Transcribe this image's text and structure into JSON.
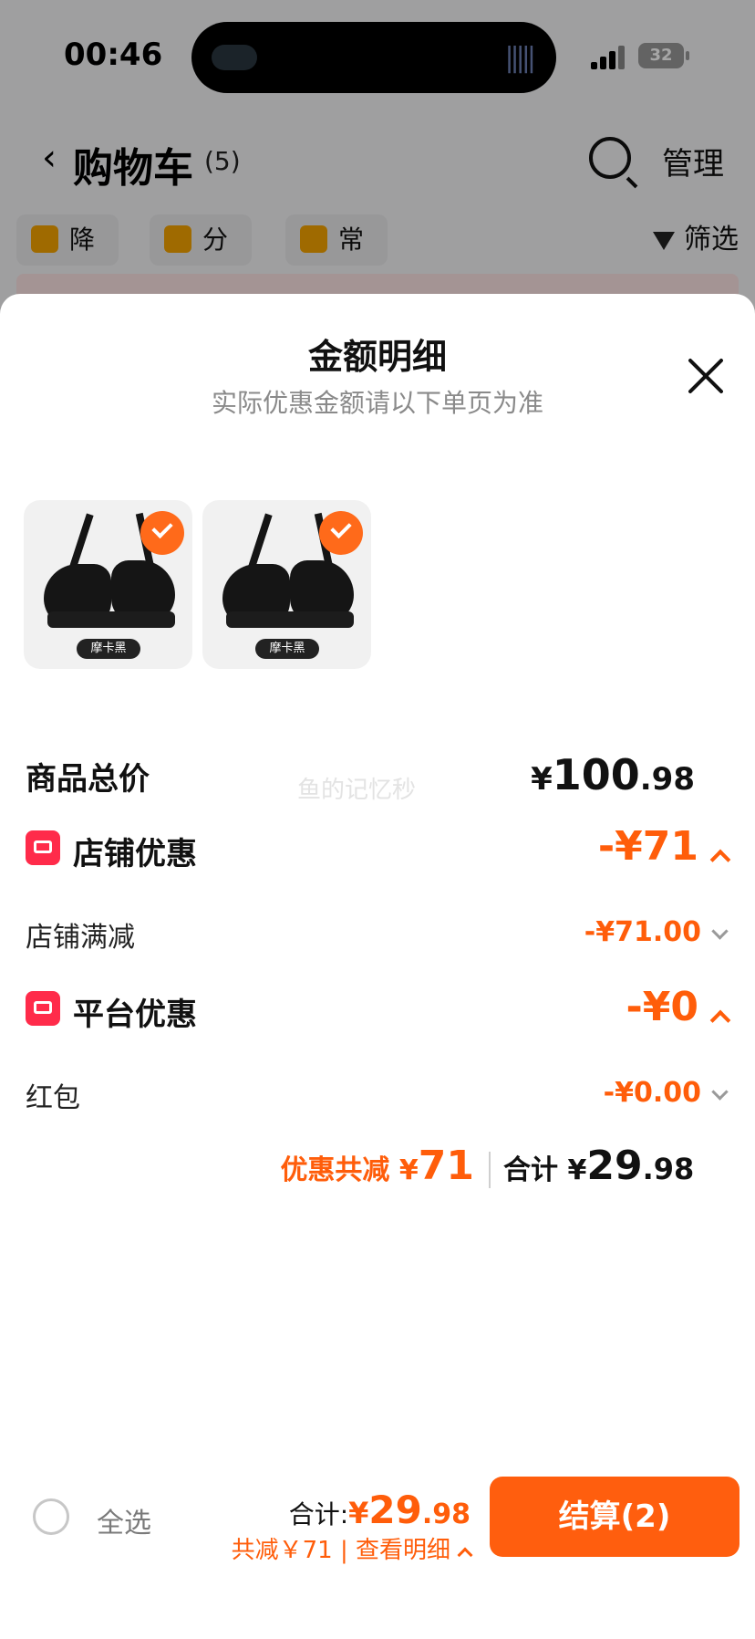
{
  "status_bar": {
    "time": "00:46",
    "battery": "32"
  },
  "nav": {
    "title": "购物车",
    "count": "(5)",
    "manage": "管理"
  },
  "chips": [
    {
      "label": "降价",
      "icon": "price-drop-icon"
    },
    {
      "label": "分组",
      "icon": "folder-icon"
    },
    {
      "label": "常购",
      "icon": "bag-icon"
    }
  ],
  "filter_label": "筛选",
  "sheet": {
    "title": "金额明细",
    "subtitle": "实际优惠金额请以下单页为准",
    "thumb_tags": [
      "摩卡黑",
      "摩卡黑"
    ],
    "watermark": "鱼的记忆秒",
    "goods_total_label": "商品总价",
    "goods_total_currency": "¥",
    "goods_total_int": "100",
    "goods_total_dec": ".98",
    "shop_discount_label": "店铺优惠",
    "shop_discount_value": "-¥71",
    "shop_full_reduction_label": "店铺满减",
    "shop_full_reduction_value": "-¥71.00",
    "platform_discount_label": "平台优惠",
    "platform_discount_value": "-¥0",
    "red_packet_label": "红包",
    "red_packet_value": "-¥0.00",
    "summary_discount_label": "优惠共减 ¥",
    "summary_discount_value": "71",
    "summary_total_label": "合计 ¥",
    "summary_total_int": "29",
    "summary_total_dec": ".98"
  },
  "bottom": {
    "select_all": "全选",
    "total_label": "合计:",
    "total_currency": "¥",
    "total_int": "29",
    "total_dec": ".98",
    "detail": "共减￥71 | 查看明细",
    "checkout": "结算(2)"
  },
  "colors": {
    "accent": "#ff5e0e",
    "badge": "#ff2b4a"
  }
}
